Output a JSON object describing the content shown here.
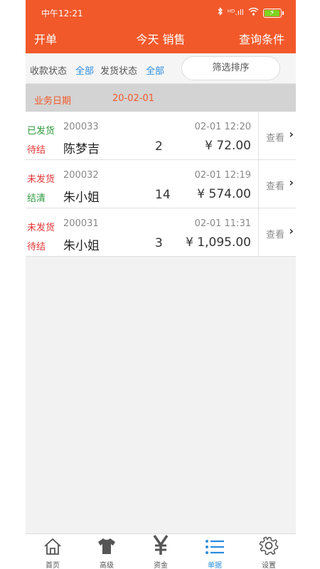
{
  "status_bar": {
    "time": "中午12:21",
    "signal": "ᴴᴰ.ıll"
  },
  "header": {
    "left": "开单",
    "title": "今天 销售",
    "right": "查询条件"
  },
  "filter": {
    "payment_label": "收款状态",
    "payment_value": "全部",
    "shipping_label": "发货状态",
    "shipping_value": "全部",
    "sort_button": "筛选排序"
  },
  "date_row": {
    "label": "业务日期",
    "value": "20-02-01"
  },
  "orders": [
    {
      "ship_status": "已发货",
      "pay_status": "待结",
      "order_no": "200033",
      "customer": "陈梦吉",
      "qty": "2",
      "time": "02-01 12:20",
      "amount": "¥ 72.00",
      "view": "查看"
    },
    {
      "ship_status": "未发货",
      "pay_status": "结清",
      "order_no": "200032",
      "customer": "朱小姐",
      "qty": "14",
      "time": "02-01 12:19",
      "amount": "¥ 574.00",
      "view": "查看"
    },
    {
      "ship_status": "未发货",
      "pay_status": "待结",
      "order_no": "200031",
      "customer": "朱小姐",
      "qty": "3",
      "time": "02-01 11:31",
      "amount": "¥ 1,095.00",
      "view": "查看"
    }
  ],
  "tabs": [
    {
      "label": "首页",
      "icon": "home-icon"
    },
    {
      "label": "高级",
      "icon": "shirt-icon"
    },
    {
      "label": "资金",
      "icon": "yen-icon"
    },
    {
      "label": "单据",
      "icon": "list-icon"
    },
    {
      "label": "设置",
      "icon": "gear-icon"
    }
  ],
  "colors": {
    "brand": "#f2592a",
    "accent": "#2a8de0",
    "shipped": "#2c9a3a",
    "pending": "#e53535"
  }
}
